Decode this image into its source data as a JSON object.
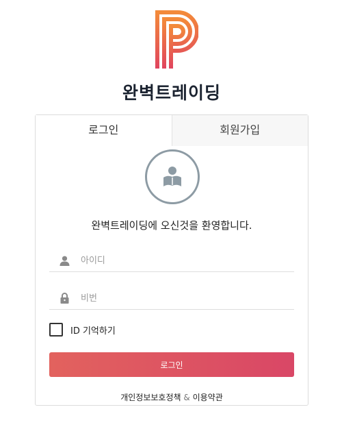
{
  "brand": {
    "title": "완벽트레이딩",
    "logo_icon": "brand-p-logo",
    "accent_colors": [
      "#f07d44",
      "#e2455f"
    ]
  },
  "tabs": {
    "login": "로그인",
    "signup": "회원가입"
  },
  "welcome": "완벽트레이딩에 오신것을 환영합니다.",
  "form": {
    "id_placeholder": "아이디",
    "password_placeholder": "비번",
    "id_icon": "user-icon",
    "password_icon": "lock-icon",
    "remember_label": "ID 기억하기",
    "remember_checked": false,
    "login_button": "로그인",
    "button_colors": [
      "#e2625e",
      "#d94766"
    ]
  },
  "footer": {
    "privacy": "개인정보보호정책",
    "separator": "&",
    "terms": "이용약관"
  }
}
